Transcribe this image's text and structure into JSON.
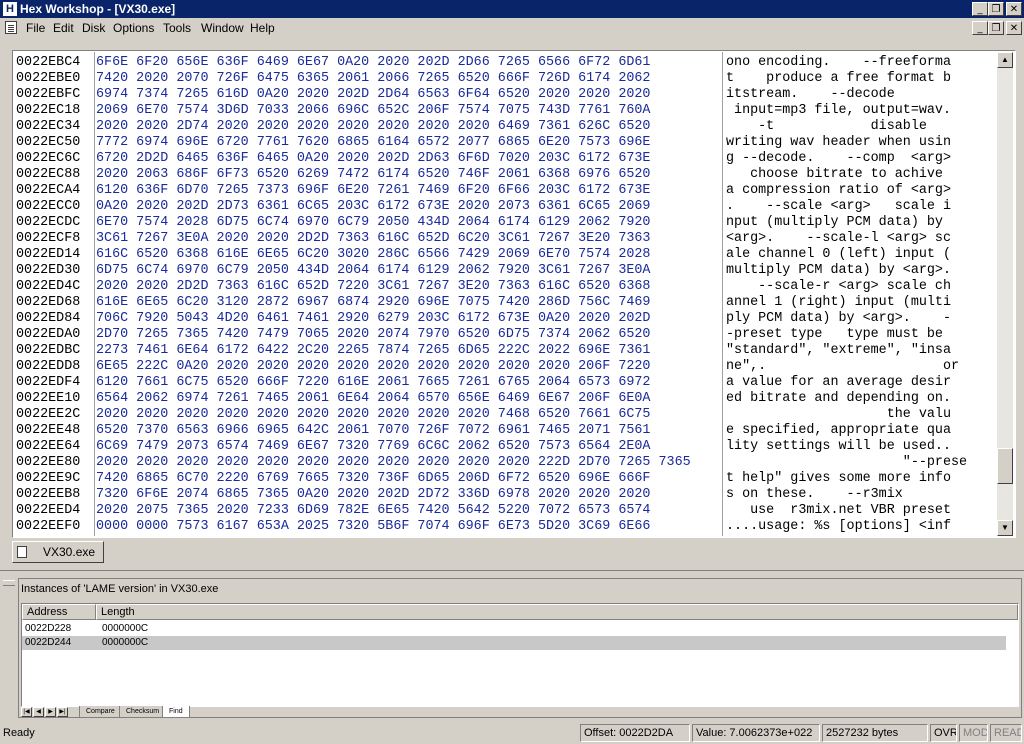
{
  "window": {
    "title": "Hex Workshop - [VX30.exe]",
    "app_icon_letter": "H",
    "controls": {
      "minimize": "_",
      "restore": "❐",
      "close": "✕"
    }
  },
  "menu": [
    "File",
    "Edit",
    "Disk",
    "Options",
    "Tools",
    "Window",
    "Help"
  ],
  "hex_rows": [
    {
      "addr": "0022EBC4",
      "hex": "6F6E 6F20 656E 636F 6469 6E67 0A20 2020 202D 2D66 7265 6566 6F72 6D61",
      "text": "ono encoding.    --freeforma"
    },
    {
      "addr": "0022EBE0",
      "hex": "7420 2020 2070 726F 6475 6365 2061 2066 7265 6520 666F 726D 6174 2062",
      "text": "t    produce a free format b"
    },
    {
      "addr": "0022EBFC",
      "hex": "6974 7374 7265 616D 0A20 2020 202D 2D64 6563 6F64 6520 2020 2020 2020",
      "text": "itstream.    --decode      "
    },
    {
      "addr": "0022EC18",
      "hex": "2069 6E70 7574 3D6D 7033 2066 696C 652C 206F 7574 7075 743D 7761 760A",
      "text": " input=mp3 file, output=wav."
    },
    {
      "addr": "0022EC34",
      "hex": "2020 2020 2D74 2020 2020 2020 2020 2020 2020 2020 6469 7361 626C 6520",
      "text": "    -t            disable "
    },
    {
      "addr": "0022EC50",
      "hex": "7772 6974 696E 6720 7761 7620 6865 6164 6572 2077 6865 6E20 7573 696E",
      "text": "writing wav header when usin"
    },
    {
      "addr": "0022EC6C",
      "hex": "6720 2D2D 6465 636F 6465 0A20 2020 202D 2D63 6F6D 7020 203C 6172 673E",
      "text": "g --decode.    --comp  <arg>"
    },
    {
      "addr": "0022EC88",
      "hex": "2020 2063 686F 6F73 6520 6269 7472 6174 6520 746F 2061 6368 6976 6520",
      "text": "   choose bitrate to achive "
    },
    {
      "addr": "0022ECA4",
      "hex": "6120 636F 6D70 7265 7373 696F 6E20 7261 7469 6F20 6F66 203C 6172 673E",
      "text": "a compression ratio of <arg>"
    },
    {
      "addr": "0022ECC0",
      "hex": "0A20 2020 202D 2D73 6361 6C65 203C 6172 673E 2020 2073 6361 6C65 2069",
      "text": ".    --scale <arg>   scale i"
    },
    {
      "addr": "0022ECDC",
      "hex": "6E70 7574 2028 6D75 6C74 6970 6C79 2050 434D 2064 6174 6129 2062 7920",
      "text": "nput (multiply PCM data) by "
    },
    {
      "addr": "0022ECF8",
      "hex": "3C61 7267 3E0A 2020 2020 2D2D 7363 616C 652D 6C20 3C61 7267 3E20 7363",
      "text": "<arg>.    --scale-l <arg> sc"
    },
    {
      "addr": "0022ED14",
      "hex": "616C 6520 6368 616E 6E65 6C20 3020 286C 6566 7429 2069 6E70 7574 2028",
      "text": "ale channel 0 (left) input ("
    },
    {
      "addr": "0022ED30",
      "hex": "6D75 6C74 6970 6C79 2050 434D 2064 6174 6129 2062 7920 3C61 7267 3E0A",
      "text": "multiply PCM data) by <arg>."
    },
    {
      "addr": "0022ED4C",
      "hex": "2020 2020 2D2D 7363 616C 652D 7220 3C61 7267 3E20 7363 616C 6520 6368",
      "text": "    --scale-r <arg> scale ch"
    },
    {
      "addr": "0022ED68",
      "hex": "616E 6E65 6C20 3120 2872 6967 6874 2920 696E 7075 7420 286D 756C 7469",
      "text": "annel 1 (right) input (multi"
    },
    {
      "addr": "0022ED84",
      "hex": "706C 7920 5043 4D20 6461 7461 2920 6279 203C 6172 673E 0A20 2020 202D",
      "text": "ply PCM data) by <arg>.    -"
    },
    {
      "addr": "0022EDA0",
      "hex": "2D70 7265 7365 7420 7479 7065 2020 2074 7970 6520 6D75 7374 2062 6520",
      "text": "-preset type   type must be "
    },
    {
      "addr": "0022EDBC",
      "hex": "2273 7461 6E64 6172 6422 2C20 2265 7874 7265 6D65 222C 2022 696E 7361",
      "text": "\"standard\", \"extreme\", \"insa"
    },
    {
      "addr": "0022EDD8",
      "hex": "6E65 222C 0A20 2020 2020 2020 2020 2020 2020 2020 2020 2020 206F 7220",
      "text": "ne\",.                      or "
    },
    {
      "addr": "0022EDF4",
      "hex": "6120 7661 6C75 6520 666F 7220 616E 2061 7665 7261 6765 2064 6573 6972",
      "text": "a value for an average desir"
    },
    {
      "addr": "0022EE10",
      "hex": "6564 2062 6974 7261 7465 2061 6E64 2064 6570 656E 6469 6E67 206F 6E0A",
      "text": "ed bitrate and depending on."
    },
    {
      "addr": "0022EE2C",
      "hex": "2020 2020 2020 2020 2020 2020 2020 2020 2020 2020 7468 6520 7661 6C75",
      "text": "                    the valu"
    },
    {
      "addr": "0022EE48",
      "hex": "6520 7370 6563 6966 6965 642C 2061 7070 726F 7072 6961 7465 2071 7561",
      "text": "e specified, appropriate qua"
    },
    {
      "addr": "0022EE64",
      "hex": "6C69 7479 2073 6574 7469 6E67 7320 7769 6C6C 2062 6520 7573 6564 2E0A",
      "text": "lity settings will be used.."
    },
    {
      "addr": "0022EE80",
      "hex": "2020 2020 2020 2020 2020 2020 2020 2020 2020 2020 2020 222D 2D70 7265 7365",
      "text": "                      \"--prese"
    },
    {
      "addr": "0022EE9C",
      "hex": "7420 6865 6C70 2220 6769 7665 7320 736F 6D65 206D 6F72 6520 696E 666F",
      "text": "t help\" gives some more info"
    },
    {
      "addr": "0022EEB8",
      "hex": "7320 6F6E 2074 6865 7365 0A20 2020 202D 2D72 336D 6978 2020 2020 2020",
      "text": "s on these.    --r3mix      "
    },
    {
      "addr": "0022EED4",
      "hex": "2020 2075 7365 2020 7233 6D69 782E 6E65 7420 5642 5220 7072 6573 6574",
      "text": "   use  r3mix.net VBR preset"
    },
    {
      "addr": "0022EEF0",
      "hex": "0000 0000 7573 6167 653A 2025 7320 5B6F 7074 696F 6E73 5D20 3C69 6E66",
      "text": "....usage: %s [options] <inf"
    }
  ],
  "doc_tab": {
    "label": "VX30.exe"
  },
  "results_panel": {
    "title": "Instances of 'LAME version' in VX30.exe",
    "columns": [
      "Address",
      "Length"
    ],
    "rows": [
      {
        "address": "0022D228",
        "length": "0000000C"
      },
      {
        "address": "0022D244",
        "length": "0000000C"
      }
    ],
    "tabs": [
      "Compare",
      "Checksum",
      "Find"
    ],
    "active_tab": "Find"
  },
  "status": {
    "ready": "Ready",
    "offset": "Offset: 0022D2DA",
    "value": "Value: 7.0062373e+022",
    "size": "2527232 bytes",
    "ovr": "OVR",
    "mod": "MOD",
    "read": "READ"
  }
}
